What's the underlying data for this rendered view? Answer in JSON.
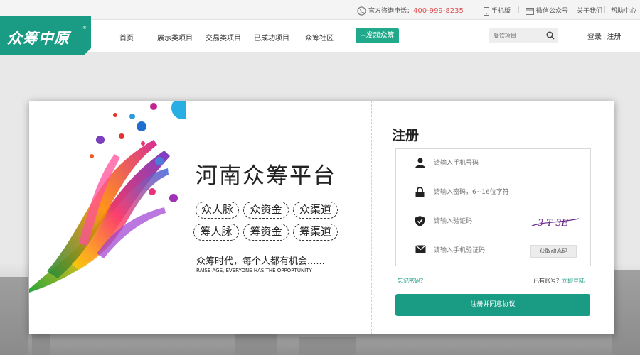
{
  "topbar": {
    "hotline_label": "官方咨询电话：",
    "hotline_number": "400-999-8235",
    "mobile": "手机版",
    "wechat": "微信公众号",
    "about": "关于我们",
    "help": "帮助中心"
  },
  "header": {
    "logo_text": "众筹中原",
    "logo_mark": "®",
    "nav": [
      "首页",
      "展示类项目",
      "交易类项目",
      "已成功项目",
      "众筹社区"
    ],
    "launch_label": "+发起众筹",
    "search_placeholder": "餐饮项目",
    "login": "登录",
    "divider": "|",
    "register": "注册"
  },
  "promo": {
    "title": "河南众筹平台",
    "tags": [
      "众人脉",
      "众资金",
      "众渠道",
      "筹人脉",
      "筹资金",
      "筹渠道"
    ],
    "slogan": "众筹时代，每个人都有机会......",
    "slogan_en": "RAISE AGE, EVERYONE HAS THE OPPORTUNITY"
  },
  "form": {
    "title": "注册",
    "phone_placeholder": "请输入手机号码",
    "password_placeholder": "请输入密码，6~16位字符",
    "captcha_placeholder": "请输入验证码",
    "captcha_text": "3 T 3E",
    "sms_placeholder": "请输入手机验证码",
    "sms_button": "获取动态码",
    "forgot": "忘记密码？",
    "has_account": "已有账号？",
    "login_now": "立即登陆",
    "submit": "注册并同意协议"
  },
  "colors": {
    "brand": "#1a9b84",
    "hotline": "#e05050"
  }
}
